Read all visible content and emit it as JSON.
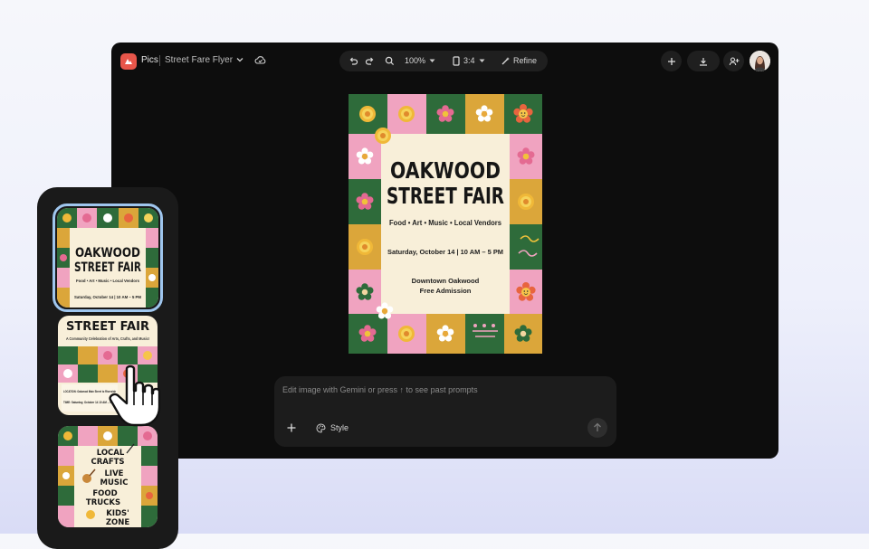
{
  "header": {
    "app_name": "Pics",
    "doc_title": "Street Fare Flyer",
    "zoom": "100%",
    "aspect": "3:4",
    "refine_label": "Refine"
  },
  "poster": {
    "title_line1": "OAKWOOD",
    "title_line2": "STREET FAIR",
    "tagline": "Food • Art • Music • Local Vendors",
    "date": "Saturday, October 14 | 10 AM – 5 PM",
    "location": "Downtown Oakwood",
    "admission": "Free Admission"
  },
  "prompt": {
    "placeholder": "Edit image with Gemini or press ↑ to see past prompts",
    "style_label": "Style"
  },
  "thumbnails": [
    {
      "title_line1": "OAKWOOD",
      "title_line2": "STREET FAIR",
      "tagline": "Food • Art • Music • Local Vendors",
      "date": "Saturday, October 14 | 10 AM – 5 PM"
    },
    {
      "title": "STREET FAIR",
      "subtitle": "A Community Celebration of Arts, Crafts, and Music!",
      "info1": "LOCATION: Oakwood Main Street to Riverside",
      "info2": "TIME: Saturday, October 14 10 AM – 5 PM"
    },
    {
      "line1": "LOCAL",
      "line2": "CRAFTS",
      "line3": "LIVE",
      "line4": "MUSIC",
      "line5": "FOOD",
      "line6": "TRUCKS",
      "line7": "KIDS'",
      "line8": "ZONE"
    }
  ],
  "colors": {
    "green": "#2e6b3a",
    "pink": "#f0a3c0",
    "mustard": "#dba63a",
    "cream": "#f8efd9",
    "accent": "#e8564a"
  }
}
